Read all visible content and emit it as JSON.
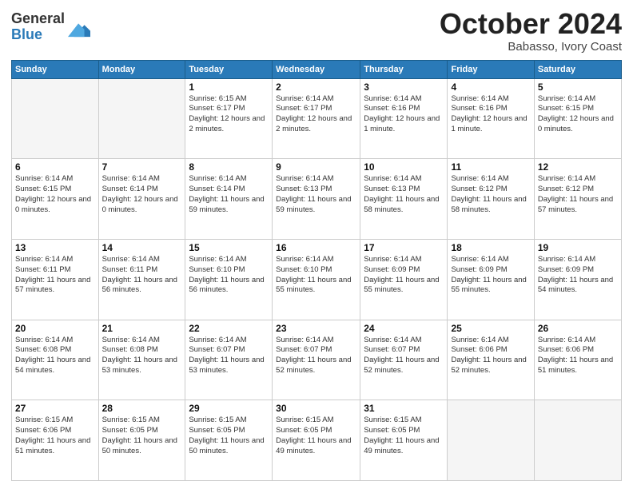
{
  "logo": {
    "general": "General",
    "blue": "Blue"
  },
  "header": {
    "month": "October 2024",
    "location": "Babasso, Ivory Coast"
  },
  "weekdays": [
    "Sunday",
    "Monday",
    "Tuesday",
    "Wednesday",
    "Thursday",
    "Friday",
    "Saturday"
  ],
  "weeks": [
    [
      {
        "day": "",
        "info": ""
      },
      {
        "day": "",
        "info": ""
      },
      {
        "day": "1",
        "info": "Sunrise: 6:15 AM\nSunset: 6:17 PM\nDaylight: 12 hours and 2 minutes."
      },
      {
        "day": "2",
        "info": "Sunrise: 6:14 AM\nSunset: 6:17 PM\nDaylight: 12 hours and 2 minutes."
      },
      {
        "day": "3",
        "info": "Sunrise: 6:14 AM\nSunset: 6:16 PM\nDaylight: 12 hours and 1 minute."
      },
      {
        "day": "4",
        "info": "Sunrise: 6:14 AM\nSunset: 6:16 PM\nDaylight: 12 hours and 1 minute."
      },
      {
        "day": "5",
        "info": "Sunrise: 6:14 AM\nSunset: 6:15 PM\nDaylight: 12 hours and 0 minutes."
      }
    ],
    [
      {
        "day": "6",
        "info": "Sunrise: 6:14 AM\nSunset: 6:15 PM\nDaylight: 12 hours and 0 minutes."
      },
      {
        "day": "7",
        "info": "Sunrise: 6:14 AM\nSunset: 6:14 PM\nDaylight: 12 hours and 0 minutes."
      },
      {
        "day": "8",
        "info": "Sunrise: 6:14 AM\nSunset: 6:14 PM\nDaylight: 11 hours and 59 minutes."
      },
      {
        "day": "9",
        "info": "Sunrise: 6:14 AM\nSunset: 6:13 PM\nDaylight: 11 hours and 59 minutes."
      },
      {
        "day": "10",
        "info": "Sunrise: 6:14 AM\nSunset: 6:13 PM\nDaylight: 11 hours and 58 minutes."
      },
      {
        "day": "11",
        "info": "Sunrise: 6:14 AM\nSunset: 6:12 PM\nDaylight: 11 hours and 58 minutes."
      },
      {
        "day": "12",
        "info": "Sunrise: 6:14 AM\nSunset: 6:12 PM\nDaylight: 11 hours and 57 minutes."
      }
    ],
    [
      {
        "day": "13",
        "info": "Sunrise: 6:14 AM\nSunset: 6:11 PM\nDaylight: 11 hours and 57 minutes."
      },
      {
        "day": "14",
        "info": "Sunrise: 6:14 AM\nSunset: 6:11 PM\nDaylight: 11 hours and 56 minutes."
      },
      {
        "day": "15",
        "info": "Sunrise: 6:14 AM\nSunset: 6:10 PM\nDaylight: 11 hours and 56 minutes."
      },
      {
        "day": "16",
        "info": "Sunrise: 6:14 AM\nSunset: 6:10 PM\nDaylight: 11 hours and 55 minutes."
      },
      {
        "day": "17",
        "info": "Sunrise: 6:14 AM\nSunset: 6:09 PM\nDaylight: 11 hours and 55 minutes."
      },
      {
        "day": "18",
        "info": "Sunrise: 6:14 AM\nSunset: 6:09 PM\nDaylight: 11 hours and 55 minutes."
      },
      {
        "day": "19",
        "info": "Sunrise: 6:14 AM\nSunset: 6:09 PM\nDaylight: 11 hours and 54 minutes."
      }
    ],
    [
      {
        "day": "20",
        "info": "Sunrise: 6:14 AM\nSunset: 6:08 PM\nDaylight: 11 hours and 54 minutes."
      },
      {
        "day": "21",
        "info": "Sunrise: 6:14 AM\nSunset: 6:08 PM\nDaylight: 11 hours and 53 minutes."
      },
      {
        "day": "22",
        "info": "Sunrise: 6:14 AM\nSunset: 6:07 PM\nDaylight: 11 hours and 53 minutes."
      },
      {
        "day": "23",
        "info": "Sunrise: 6:14 AM\nSunset: 6:07 PM\nDaylight: 11 hours and 52 minutes."
      },
      {
        "day": "24",
        "info": "Sunrise: 6:14 AM\nSunset: 6:07 PM\nDaylight: 11 hours and 52 minutes."
      },
      {
        "day": "25",
        "info": "Sunrise: 6:14 AM\nSunset: 6:06 PM\nDaylight: 11 hours and 52 minutes."
      },
      {
        "day": "26",
        "info": "Sunrise: 6:14 AM\nSunset: 6:06 PM\nDaylight: 11 hours and 51 minutes."
      }
    ],
    [
      {
        "day": "27",
        "info": "Sunrise: 6:15 AM\nSunset: 6:06 PM\nDaylight: 11 hours and 51 minutes."
      },
      {
        "day": "28",
        "info": "Sunrise: 6:15 AM\nSunset: 6:05 PM\nDaylight: 11 hours and 50 minutes."
      },
      {
        "day": "29",
        "info": "Sunrise: 6:15 AM\nSunset: 6:05 PM\nDaylight: 11 hours and 50 minutes."
      },
      {
        "day": "30",
        "info": "Sunrise: 6:15 AM\nSunset: 6:05 PM\nDaylight: 11 hours and 49 minutes."
      },
      {
        "day": "31",
        "info": "Sunrise: 6:15 AM\nSunset: 6:05 PM\nDaylight: 11 hours and 49 minutes."
      },
      {
        "day": "",
        "info": ""
      },
      {
        "day": "",
        "info": ""
      }
    ]
  ]
}
